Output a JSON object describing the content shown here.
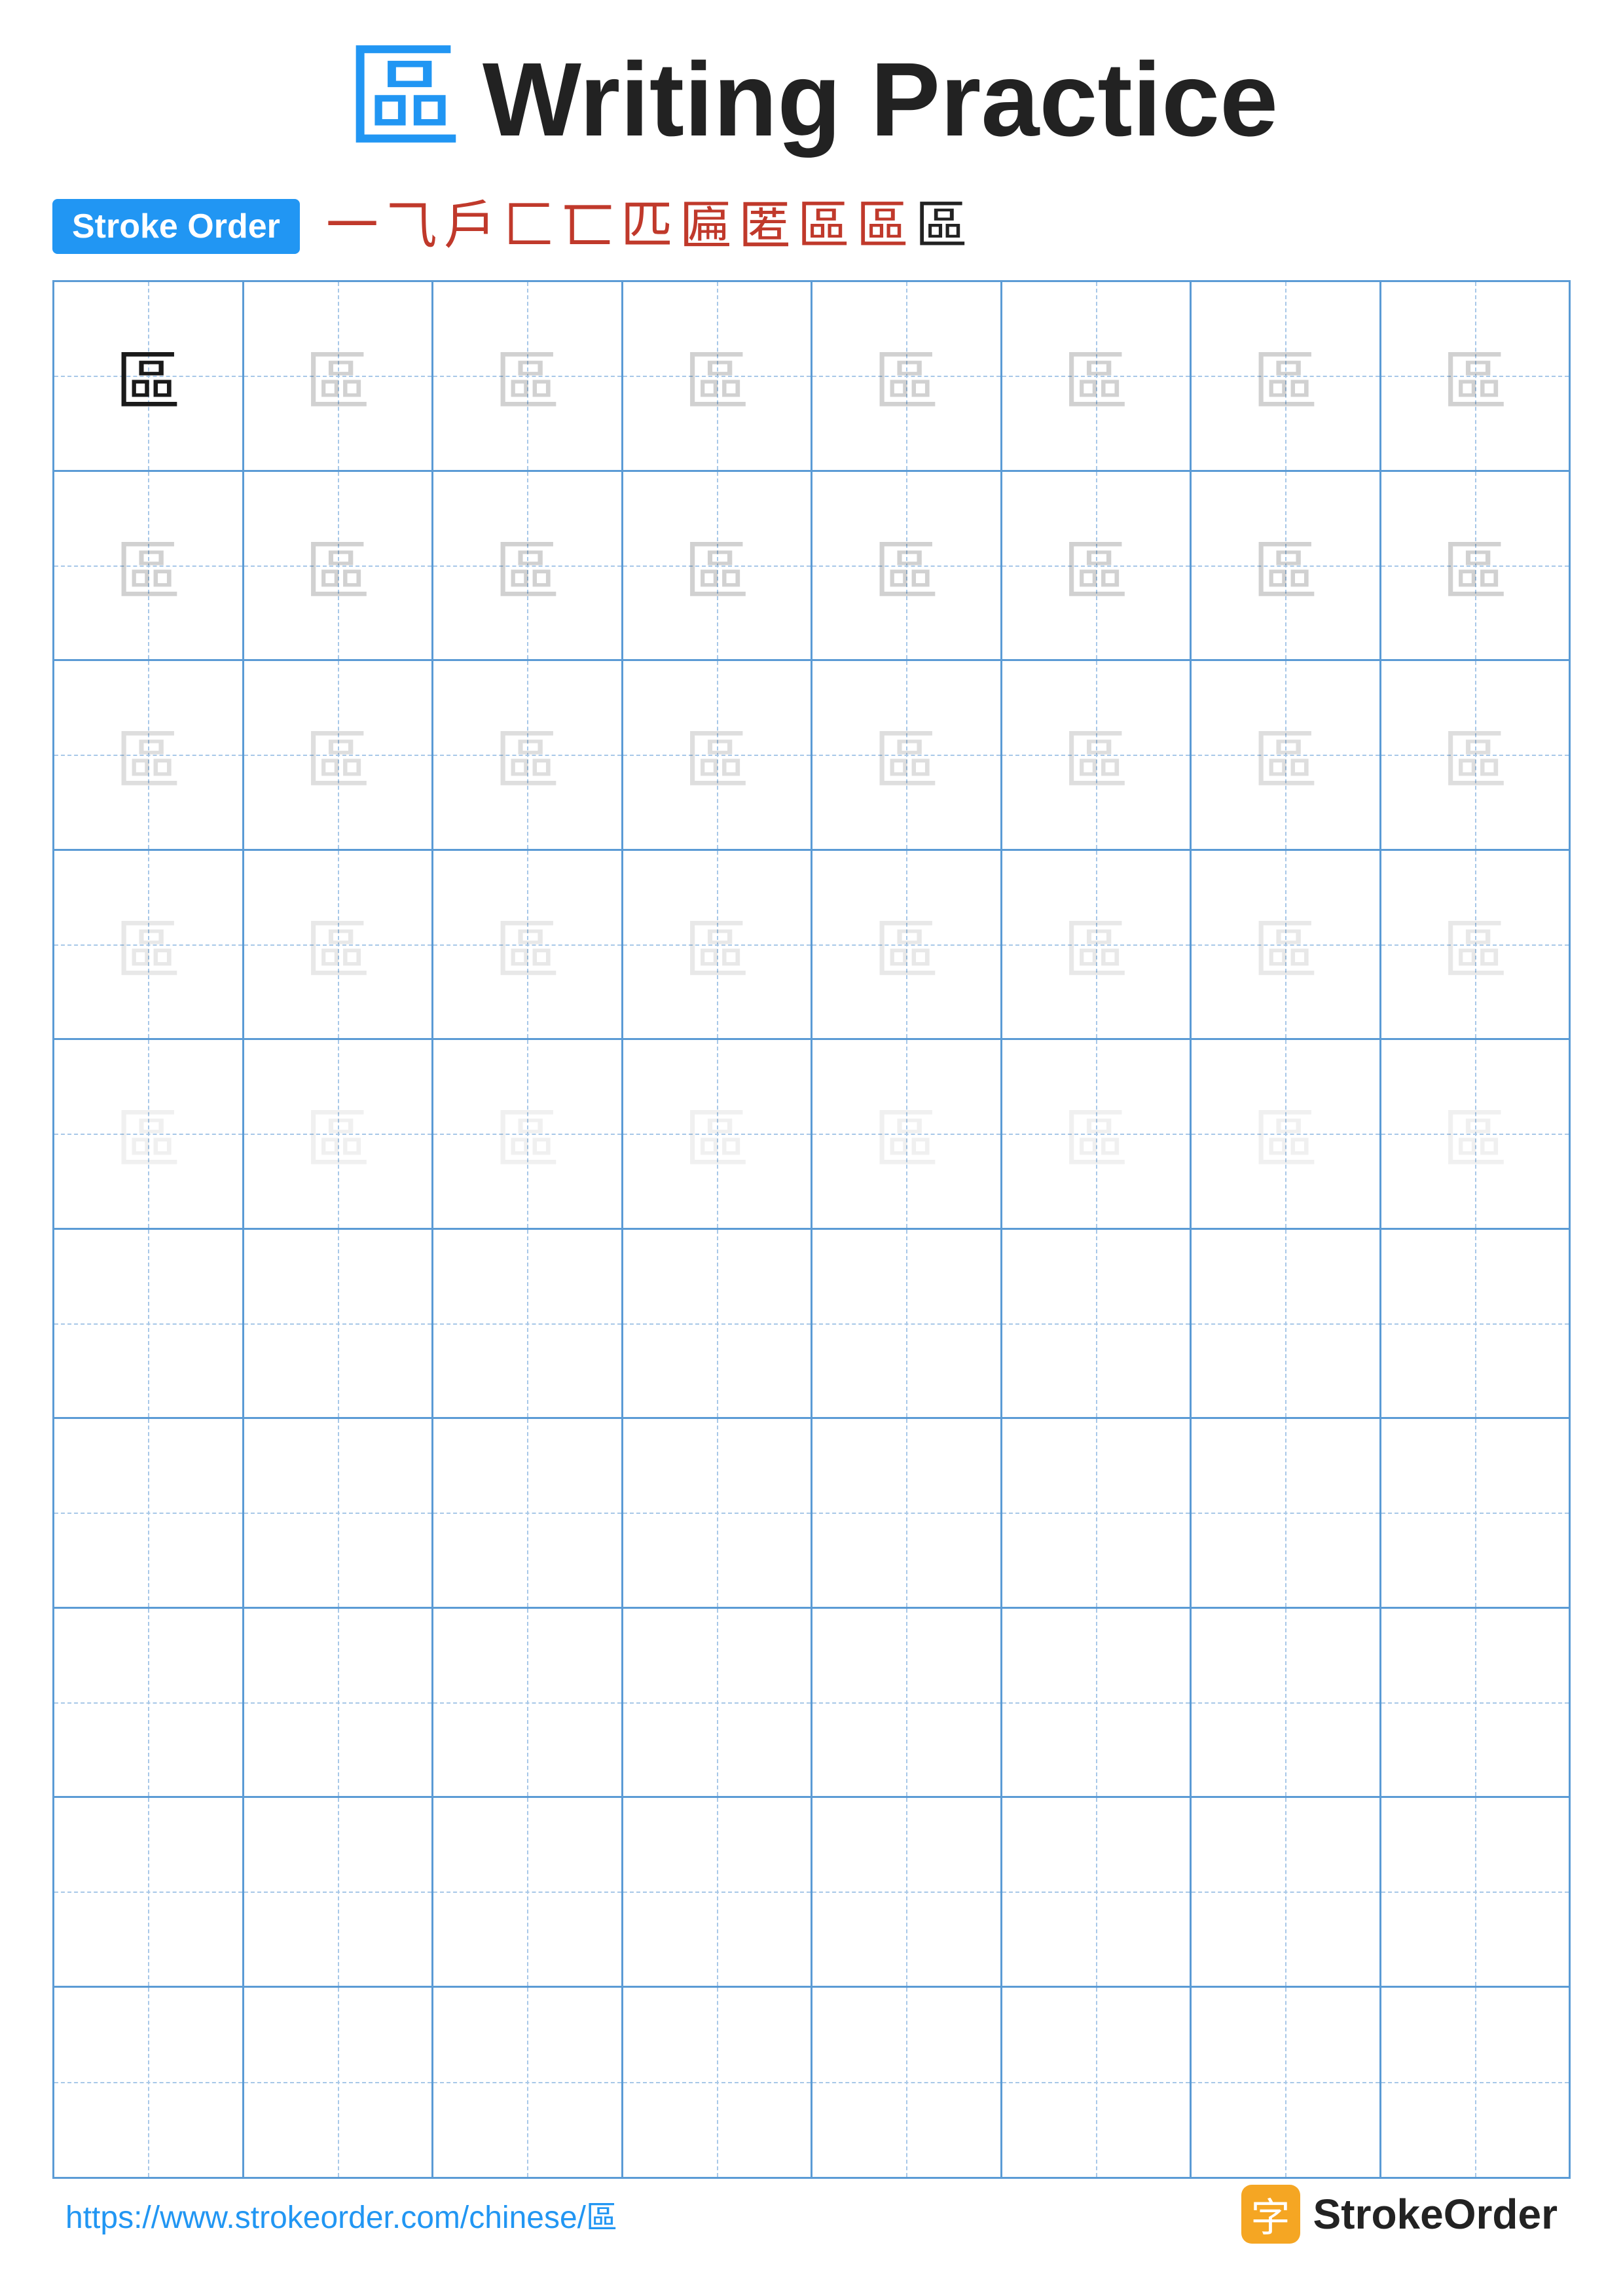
{
  "title": {
    "char": "區",
    "text": "Writing Practice"
  },
  "stroke_order": {
    "badge_label": "Stroke Order",
    "steps": [
      "一",
      "㇀",
      "戶",
      "匚",
      "匸",
      "匹",
      "匾",
      "區",
      "區",
      "區",
      "區"
    ]
  },
  "grid": {
    "cols": 8,
    "rows": 10,
    "char": "區",
    "practice_rows": 5,
    "empty_rows": 5,
    "ghost_levels": [
      "dark",
      "ghost-1",
      "ghost-1",
      "ghost-2",
      "ghost-2",
      "ghost-3",
      "ghost-3",
      "ghost-4"
    ],
    "row_ghosts": [
      [
        "dark",
        "ghost-1",
        "ghost-1",
        "ghost-1",
        "ghost-1",
        "ghost-1",
        "ghost-1",
        "ghost-1"
      ],
      [
        "ghost-1",
        "ghost-1",
        "ghost-1",
        "ghost-1",
        "ghost-1",
        "ghost-1",
        "ghost-1",
        "ghost-1"
      ],
      [
        "ghost-2",
        "ghost-2",
        "ghost-2",
        "ghost-2",
        "ghost-2",
        "ghost-2",
        "ghost-2",
        "ghost-2"
      ],
      [
        "ghost-3",
        "ghost-3",
        "ghost-3",
        "ghost-3",
        "ghost-3",
        "ghost-3",
        "ghost-3",
        "ghost-3"
      ],
      [
        "ghost-4",
        "ghost-4",
        "ghost-4",
        "ghost-4",
        "ghost-4",
        "ghost-4",
        "ghost-4",
        "ghost-4"
      ]
    ]
  },
  "footer": {
    "url": "https://www.strokeorder.com/chinese/區",
    "brand_text": "StrokeOrder",
    "brand_icon": "字"
  }
}
